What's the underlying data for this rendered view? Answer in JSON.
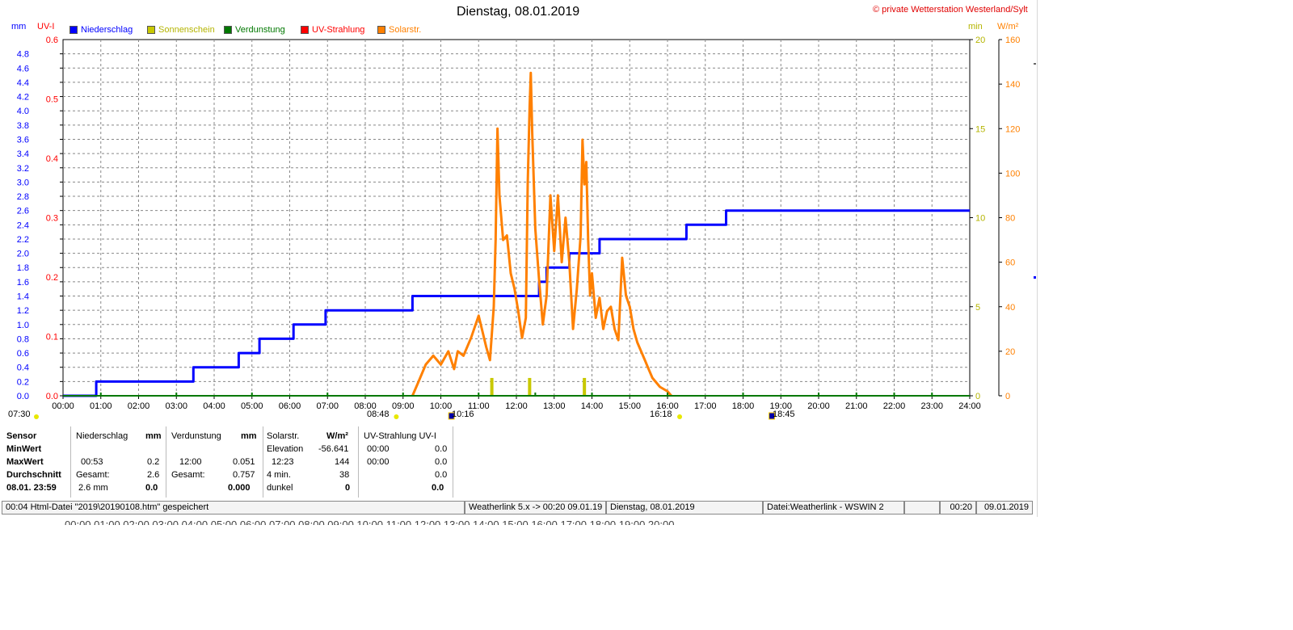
{
  "header": {
    "title": "Dienstag, 08.01.2019",
    "copyright": "© private Wetterstation Westerland/Sylt"
  },
  "axis_units": {
    "mm": "mm",
    "uvi": "UV-I",
    "min": "min",
    "wm2": "W/m²"
  },
  "legend": [
    {
      "label": "Niederschlag",
      "color": "#0000ff",
      "text_color": "#0000ff"
    },
    {
      "label": "Sonnenschein",
      "color": "#c8c800",
      "text_color": "#b4b400"
    },
    {
      "label": "Verdunstung",
      "color": "#007800",
      "text_color": "#007800"
    },
    {
      "label": "UV-Strahlung",
      "color": "#ff0000",
      "text_color": "#ff0000"
    },
    {
      "label": "Solarstr.",
      "color": "#ff8000",
      "text_color": "#ff8000"
    }
  ],
  "time_markers": {
    "sunrise_time": "07:30",
    "markers": [
      {
        "label": "08:48",
        "icon": "sun-icon"
      },
      {
        "label": "10:16",
        "icon": "moon-icon"
      },
      {
        "label": "16:18",
        "icon": "sun-icon"
      },
      {
        "label": "18:45",
        "icon": "moon-icon"
      }
    ]
  },
  "chart_data": {
    "type": "line",
    "title": "Dienstag, 08.01.2019",
    "x_ticks": [
      "00:00",
      "01:00",
      "02:00",
      "03:00",
      "04:00",
      "05:00",
      "06:00",
      "07:00",
      "08:00",
      "09:00",
      "10:00",
      "11:00",
      "12:00",
      "13:00",
      "14:00",
      "15:00",
      "16:00",
      "17:00",
      "18:00",
      "19:00",
      "20:00",
      "21:00",
      "22:00",
      "23:00",
      "24:00"
    ],
    "xlim_hours": [
      0,
      24
    ],
    "left_axis_mm": {
      "range": [
        0,
        5.0
      ],
      "ticks": [
        "0.0",
        "0.2",
        "0.4",
        "0.6",
        "0.8",
        "1.0",
        "1.2",
        "1.4",
        "1.6",
        "1.8",
        "2.0",
        "2.2",
        "2.4",
        "2.6",
        "2.8",
        "3.0",
        "3.2",
        "3.4",
        "3.6",
        "3.8",
        "4.0",
        "4.2",
        "4.4",
        "4.6",
        "4.8"
      ],
      "color": "#0000ff"
    },
    "left_axis_uvi": {
      "range": [
        0,
        0.6
      ],
      "ticks": [
        "0.0",
        "0.1",
        "0.2",
        "0.3",
        "0.4",
        "0.5",
        "0.6"
      ],
      "color": "#ff0000"
    },
    "right_axis_min": {
      "range": [
        0,
        20
      ],
      "ticks": [
        "0",
        "5",
        "10",
        "15",
        "20"
      ],
      "color": "#b4b400"
    },
    "right_axis_wm2": {
      "range": [
        0,
        160
      ],
      "ticks": [
        "0",
        "20",
        "40",
        "60",
        "80",
        "100",
        "120",
        "140",
        "160"
      ],
      "color": "#ff8000"
    },
    "grid": true,
    "series": [
      {
        "name": "Niederschlag",
        "unit": "mm",
        "axis": "mm",
        "color": "#0000ff",
        "step": true,
        "points": [
          [
            0,
            0
          ],
          [
            0.88,
            0
          ],
          [
            0.88,
            0.2
          ],
          [
            3.45,
            0.2
          ],
          [
            3.45,
            0.4
          ],
          [
            4.65,
            0.4
          ],
          [
            4.65,
            0.6
          ],
          [
            5.2,
            0.6
          ],
          [
            5.2,
            0.8
          ],
          [
            6.1,
            0.8
          ],
          [
            6.1,
            1.0
          ],
          [
            6.95,
            1.0
          ],
          [
            6.95,
            1.2
          ],
          [
            9.25,
            1.2
          ],
          [
            9.25,
            1.4
          ],
          [
            12.6,
            1.4
          ],
          [
            12.6,
            1.6
          ],
          [
            12.8,
            1.6
          ],
          [
            12.8,
            1.8
          ],
          [
            13.4,
            1.8
          ],
          [
            13.4,
            2.0
          ],
          [
            14.2,
            2.0
          ],
          [
            14.2,
            2.2
          ],
          [
            16.5,
            2.2
          ],
          [
            16.5,
            2.4
          ],
          [
            17.55,
            2.4
          ],
          [
            17.55,
            2.6
          ],
          [
            24,
            2.6
          ]
        ]
      },
      {
        "name": "Solarstr.",
        "unit": "W/m²",
        "axis": "wm2",
        "color": "#ff8000",
        "points": [
          [
            9.25,
            0
          ],
          [
            9.4,
            6
          ],
          [
            9.6,
            14
          ],
          [
            9.8,
            18
          ],
          [
            10.0,
            14
          ],
          [
            10.2,
            20
          ],
          [
            10.35,
            12
          ],
          [
            10.45,
            20
          ],
          [
            10.6,
            18
          ],
          [
            10.8,
            26
          ],
          [
            11.0,
            36
          ],
          [
            11.2,
            22
          ],
          [
            11.3,
            16
          ],
          [
            11.4,
            40
          ],
          [
            11.45,
            70
          ],
          [
            11.5,
            120
          ],
          [
            11.55,
            90
          ],
          [
            11.65,
            70
          ],
          [
            11.75,
            72
          ],
          [
            11.85,
            55
          ],
          [
            11.95,
            48
          ],
          [
            12.05,
            38
          ],
          [
            12.15,
            26
          ],
          [
            12.25,
            35
          ],
          [
            12.3,
            95
          ],
          [
            12.35,
            130
          ],
          [
            12.38,
            145
          ],
          [
            12.42,
            118
          ],
          [
            12.5,
            75
          ],
          [
            12.6,
            52
          ],
          [
            12.7,
            32
          ],
          [
            12.8,
            45
          ],
          [
            12.9,
            90
          ],
          [
            13.0,
            65
          ],
          [
            13.1,
            90
          ],
          [
            13.2,
            60
          ],
          [
            13.3,
            80
          ],
          [
            13.4,
            60
          ],
          [
            13.5,
            30
          ],
          [
            13.6,
            48
          ],
          [
            13.7,
            72
          ],
          [
            13.75,
            115
          ],
          [
            13.8,
            95
          ],
          [
            13.85,
            105
          ],
          [
            13.9,
            70
          ],
          [
            13.95,
            45
          ],
          [
            14.0,
            55
          ],
          [
            14.1,
            35
          ],
          [
            14.2,
            44
          ],
          [
            14.3,
            30
          ],
          [
            14.4,
            38
          ],
          [
            14.5,
            40
          ],
          [
            14.6,
            30
          ],
          [
            14.7,
            25
          ],
          [
            14.8,
            62
          ],
          [
            14.9,
            45
          ],
          [
            15.0,
            40
          ],
          [
            15.1,
            30
          ],
          [
            15.2,
            24
          ],
          [
            15.3,
            20
          ],
          [
            15.4,
            16
          ],
          [
            15.5,
            12
          ],
          [
            15.6,
            8
          ],
          [
            15.8,
            4
          ],
          [
            16.0,
            2
          ],
          [
            16.1,
            0
          ]
        ]
      },
      {
        "name": "Sonnenschein",
        "unit": "min",
        "axis": "min",
        "color": "#c8c800",
        "bars": [
          [
            11.35,
            1.0
          ],
          [
            12.35,
            1.0
          ],
          [
            13.8,
            1.0
          ]
        ]
      },
      {
        "name": "Verdunstung",
        "unit": "mm",
        "axis": "mm",
        "color": "#007800",
        "points": [
          [
            0,
            0
          ],
          [
            24,
            0
          ]
        ]
      },
      {
        "name": "UV-Strahlung",
        "unit": "UV-I",
        "axis": "uvi",
        "color": "#ff0000",
        "points": []
      }
    ]
  },
  "stats": {
    "row_labels": [
      "Sensor",
      "MinWert",
      "MaxWert",
      "Durchschnitt",
      "08.01.  23:59"
    ],
    "niederschlag": {
      "title": "Niederschlag",
      "unit": "mm",
      "max_time": "00:53",
      "max_val": "0.2",
      "avg_label": "Gesamt:",
      "avg_val": "2.6",
      "day_label": "2.6 mm",
      "day_val": "0.0"
    },
    "verdunstung": {
      "title": "Verdunstung",
      "unit": "mm",
      "max_time": "12:00",
      "max_val": "0.051",
      "avg_label": "Gesamt:",
      "avg_val": "0.757",
      "day_val": "0.000"
    },
    "solar": {
      "title": "Solarstr.",
      "unit": "W/m²",
      "min_label": "Elevation",
      "min_val": "-56.641",
      "max_time": "12:23",
      "max_val": "144",
      "avg_label": "4 min.",
      "avg_val": "38",
      "day_label": "dunkel",
      "day_val": "0"
    },
    "uv": {
      "title": "UV-Strahlung UV-I",
      "min_time": "00:00",
      "min_val": "0.0",
      "max_time": "00:00",
      "max_val": "0.0",
      "avg_val": "0.0",
      "day_val": "0.0"
    }
  },
  "statusbar": {
    "left": "00:04  Html-Datei  \"2019\\20190108.htm\"  gespeichert",
    "weatherlink": "Weatherlink 5.x -> 00:20  09.01.19",
    "date": "Dienstag, 08.01.2019",
    "file": "Datei:Weatherlink - WSWIN 2",
    "blank": "",
    "time": "00:20",
    "today": "09.01.2019"
  },
  "ghost_axis": "00:00    01:00    02:00    03:00    04:00    05:00    06:00    07:00    08:00    09:00    10:00    11:00    12:00    13:00    14:00    15:00    16:00    17:00    18:00    19:00    20:00"
}
